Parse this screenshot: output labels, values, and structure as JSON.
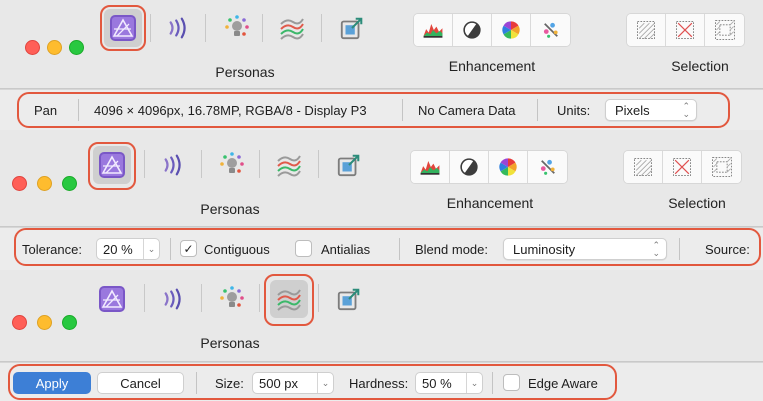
{
  "accent_color": "#e2583e",
  "panel1": {
    "toolbar": {
      "personas_label": "Personas",
      "enhancement_label": "Enhancement",
      "selection_label": "Selection",
      "persona_icons": [
        "photo-persona-icon",
        "liquify-persona-icon",
        "develop-persona-icon",
        "tone-mapping-persona-icon",
        "export-persona-icon"
      ],
      "selected_persona": "photo-persona-icon"
    },
    "context": {
      "tool": "Pan",
      "document_info": "4096 × 4096px, 16.78MP, RGBA/8 - Display P3",
      "camera": "No Camera Data",
      "units_label": "Units:",
      "units_value": "Pixels"
    }
  },
  "panel2": {
    "toolbar": {
      "personas_label": "Personas",
      "enhancement_label": "Enhancement",
      "selection_label": "Selection",
      "selected_persona": "photo-persona-icon"
    },
    "context": {
      "tolerance_label": "Tolerance:",
      "tolerance_value": "20 %",
      "contiguous_label": "Contiguous",
      "contiguous_checked": true,
      "antialias_label": "Antialias",
      "antialias_checked": false,
      "blend_mode_label": "Blend mode:",
      "blend_mode_value": "Luminosity",
      "source_label": "Source:"
    }
  },
  "panel3": {
    "toolbar": {
      "personas_label": "Personas",
      "selected_persona": "tone-mapping-persona-icon"
    },
    "context": {
      "apply_label": "Apply",
      "cancel_label": "Cancel",
      "size_label": "Size:",
      "size_value": "500 px",
      "hardness_label": "Hardness:",
      "hardness_value": "50 %",
      "edge_aware_label": "Edge Aware",
      "edge_aware_checked": false
    }
  }
}
